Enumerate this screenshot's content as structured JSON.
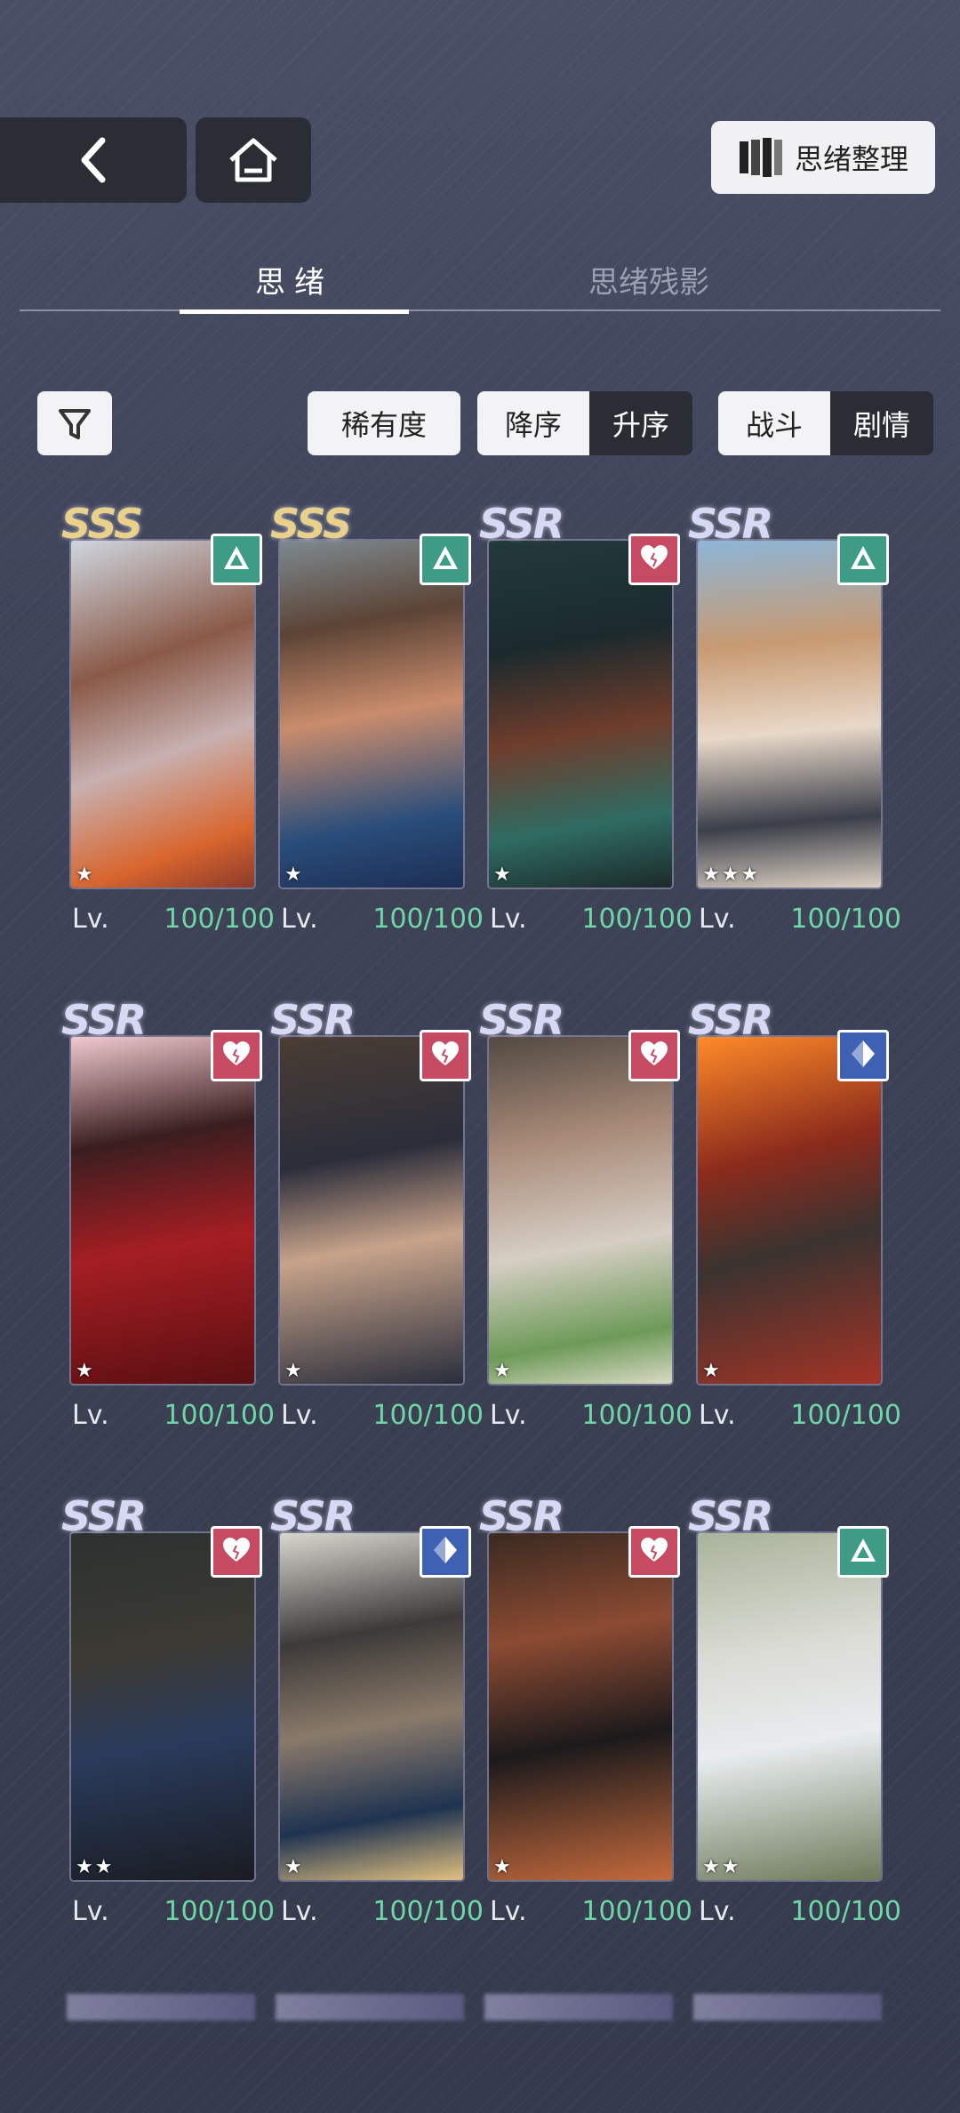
{
  "header": {
    "organize_label": "思绪整理"
  },
  "tabs": [
    {
      "label": "思绪"
    },
    {
      "label": "思绪残影"
    }
  ],
  "filters": {
    "rarity_label": "稀有度",
    "order": {
      "active": "降序",
      "inactive": "升序"
    },
    "mode": {
      "active": "战斗",
      "inactive": "剧情"
    }
  },
  "cards": [
    {
      "rarity": "SSS",
      "badge": "green-triangle",
      "stars": "★",
      "lv_label": "Lv.",
      "lv_value": "100/100"
    },
    {
      "rarity": "SSS",
      "badge": "green-triangle",
      "stars": "★",
      "lv_label": "Lv.",
      "lv_value": "100/100"
    },
    {
      "rarity": "SSR",
      "badge": "red-heart",
      "stars": "★",
      "lv_label": "Lv.",
      "lv_value": "100/100"
    },
    {
      "rarity": "SSR",
      "badge": "green-triangle",
      "stars": "★★★",
      "lv_label": "Lv.",
      "lv_value": "100/100"
    },
    {
      "rarity": "SSR",
      "badge": "red-heart",
      "stars": "★",
      "lv_label": "Lv.",
      "lv_value": "100/100"
    },
    {
      "rarity": "SSR",
      "badge": "red-heart",
      "stars": "★",
      "lv_label": "Lv.",
      "lv_value": "100/100"
    },
    {
      "rarity": "SSR",
      "badge": "red-heart",
      "stars": "★",
      "lv_label": "Lv.",
      "lv_value": "100/100"
    },
    {
      "rarity": "SSR",
      "badge": "blue-diamond",
      "stars": "★",
      "lv_label": "Lv.",
      "lv_value": "100/100"
    },
    {
      "rarity": "SSR",
      "badge": "red-heart",
      "stars": "★★",
      "lv_label": "Lv.",
      "lv_value": "100/100"
    },
    {
      "rarity": "SSR",
      "badge": "blue-diamond",
      "stars": "★",
      "lv_label": "Lv.",
      "lv_value": "100/100"
    },
    {
      "rarity": "SSR",
      "badge": "red-heart",
      "stars": "★",
      "lv_label": "Lv.",
      "lv_value": "100/100"
    },
    {
      "rarity": "SSR",
      "badge": "green-triangle",
      "stars": "★★",
      "lv_label": "Lv.",
      "lv_value": "100/100"
    }
  ],
  "colors": {
    "level": "#6fd6a6",
    "badge_green": "#3e9c86",
    "badge_red": "#c54a62",
    "badge_blue": "#3f61b4"
  }
}
